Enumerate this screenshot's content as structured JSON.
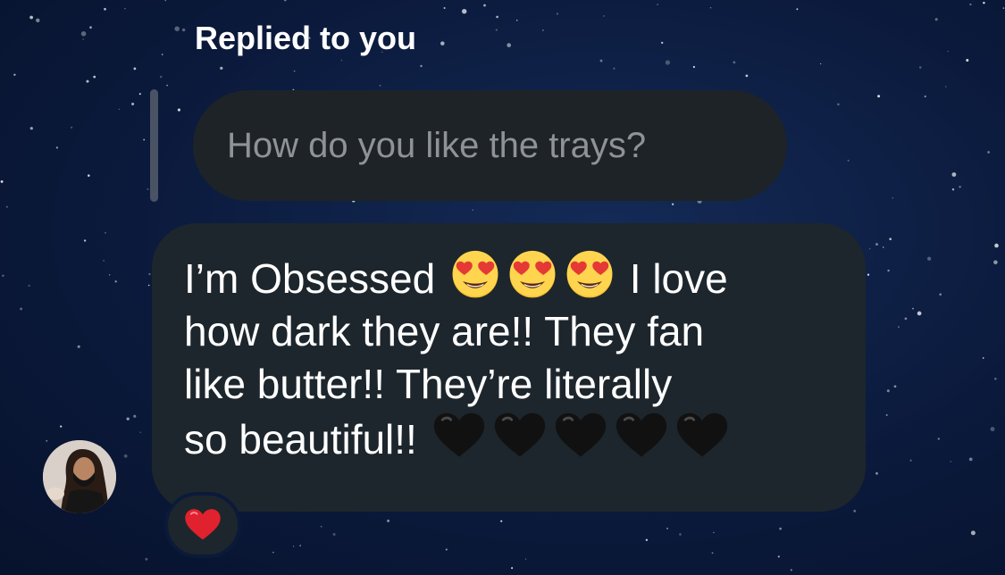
{
  "reply_header": {
    "label": "Replied to you"
  },
  "quoted_message": {
    "text": "How do you like the trays?"
  },
  "message": {
    "line1_start": "I’m Obsessed",
    "line1_end": "I love",
    "line2": "how dark they are!! They fan",
    "line3": "like butter!! They’re literally",
    "line4": "so beautiful!!",
    "emojis_line1": [
      "heart-eyes-emoji",
      "heart-eyes-emoji",
      "heart-eyes-emoji"
    ],
    "emojis_line4": [
      "black-heart-emoji",
      "black-heart-emoji",
      "black-heart-emoji",
      "black-heart-emoji",
      "black-heart-emoji"
    ]
  },
  "reaction": {
    "icon": "red-heart-emoji"
  },
  "sender": {
    "avatar_icon": "avatar"
  },
  "colors": {
    "bubble": "#1d262c",
    "quoted_bubble": "#1d2327",
    "quoted_text": "#8f9296",
    "background": "#0b1a3c",
    "reaction_heart": "#e0222e"
  }
}
